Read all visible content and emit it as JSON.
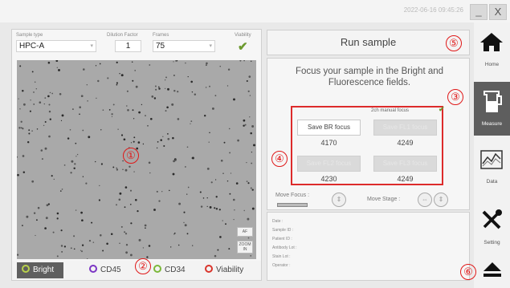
{
  "titlebar": {
    "datetime": "2022-06-16 09:45:26",
    "minimize": "_",
    "close": "X"
  },
  "params": {
    "sample_type_label": "Sample type",
    "sample_type_value": "HPC-A",
    "dilution_label": "Dilution Factor",
    "dilution_value": "1",
    "frames_label": "Frames",
    "frames_value": "75",
    "viability_label": "Viability"
  },
  "image_controls": {
    "af": "AF",
    "zoom": "ZOOM IN"
  },
  "channels": [
    {
      "label": "Bright",
      "color": "#b9d24b"
    },
    {
      "label": "CD45",
      "color": "#7b35c4"
    },
    {
      "label": "CD34",
      "color": "#7bb83a"
    },
    {
      "label": "Viability",
      "color": "#d9342b"
    }
  ],
  "run": {
    "label": "Run sample"
  },
  "instructions": "Focus your sample in the Bright and Fluorescence fields.",
  "focus": {
    "manual_label": "2ch manual focus",
    "br_button": "Save BR focus",
    "br_value": "4170",
    "fl1_button": "Save FL1 focus",
    "fl1_value": "4249",
    "fl2_button": "Save FL2 focus",
    "fl2_value": "4230",
    "fl3_button": "Save FL3 focus",
    "fl3_value": "4249"
  },
  "move": {
    "focus_label": "Move Focus :",
    "stage_label": "Move Stage :"
  },
  "info_fields": [
    "Date :",
    "Sample ID :",
    "Patient ID :",
    "Antibody Lot :",
    "Stain Lot :",
    "Operator :"
  ],
  "nav": [
    {
      "label": "Home",
      "icon": "home-icon"
    },
    {
      "label": "Measure",
      "icon": "beaker-icon"
    },
    {
      "label": "Data",
      "icon": "chart-icon"
    },
    {
      "label": "Setting",
      "icon": "tools-icon"
    }
  ],
  "callouts": [
    "①",
    "②",
    "③",
    "④",
    "⑤",
    "⑥"
  ],
  "colors": {
    "callout": "#e01818",
    "active_nav": "#5e5e5e",
    "check": "#6c9a2f"
  }
}
